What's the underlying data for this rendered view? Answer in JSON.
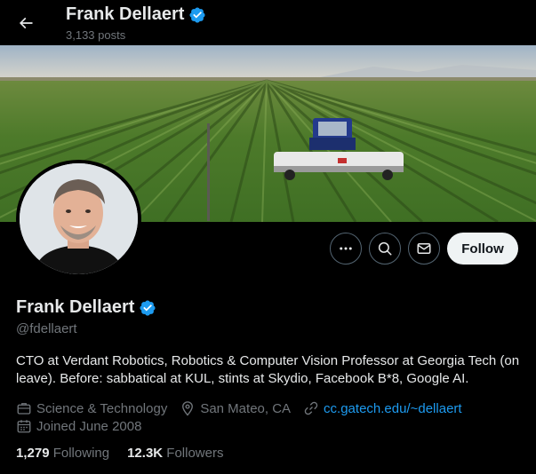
{
  "header": {
    "name": "Frank Dellaert",
    "posts": "3,133 posts"
  },
  "icons": {
    "back": "arrow-left-icon",
    "verified": "verified-badge-icon",
    "more": "more-icon",
    "search": "search-icon",
    "message": "mail-icon",
    "category": "briefcase-icon",
    "location": "location-pin-icon",
    "website": "link-icon",
    "joined": "calendar-icon"
  },
  "actions": {
    "follow_label": "Follow"
  },
  "profile": {
    "name": "Frank Dellaert",
    "handle": "@fdellaert",
    "bio": "CTO at Verdant Robotics, Robotics & Computer Vision Professor at Georgia Tech (on leave). Before: sabbatical at KUL, stints at Skydio, Facebook B*8, Google AI.",
    "category": "Science & Technology",
    "location": "San Mateo, CA",
    "website": "cc.gatech.edu/~dellaert",
    "joined": "Joined June 2008"
  },
  "stats": {
    "following_count": "1,279",
    "following_label": "Following",
    "followers_count": "12.3K",
    "followers_label": "Followers"
  },
  "colors": {
    "background": "#000000",
    "accent": "#1d9bf0",
    "secondary_text": "#71767b",
    "follow_bg": "#eff3f4"
  }
}
